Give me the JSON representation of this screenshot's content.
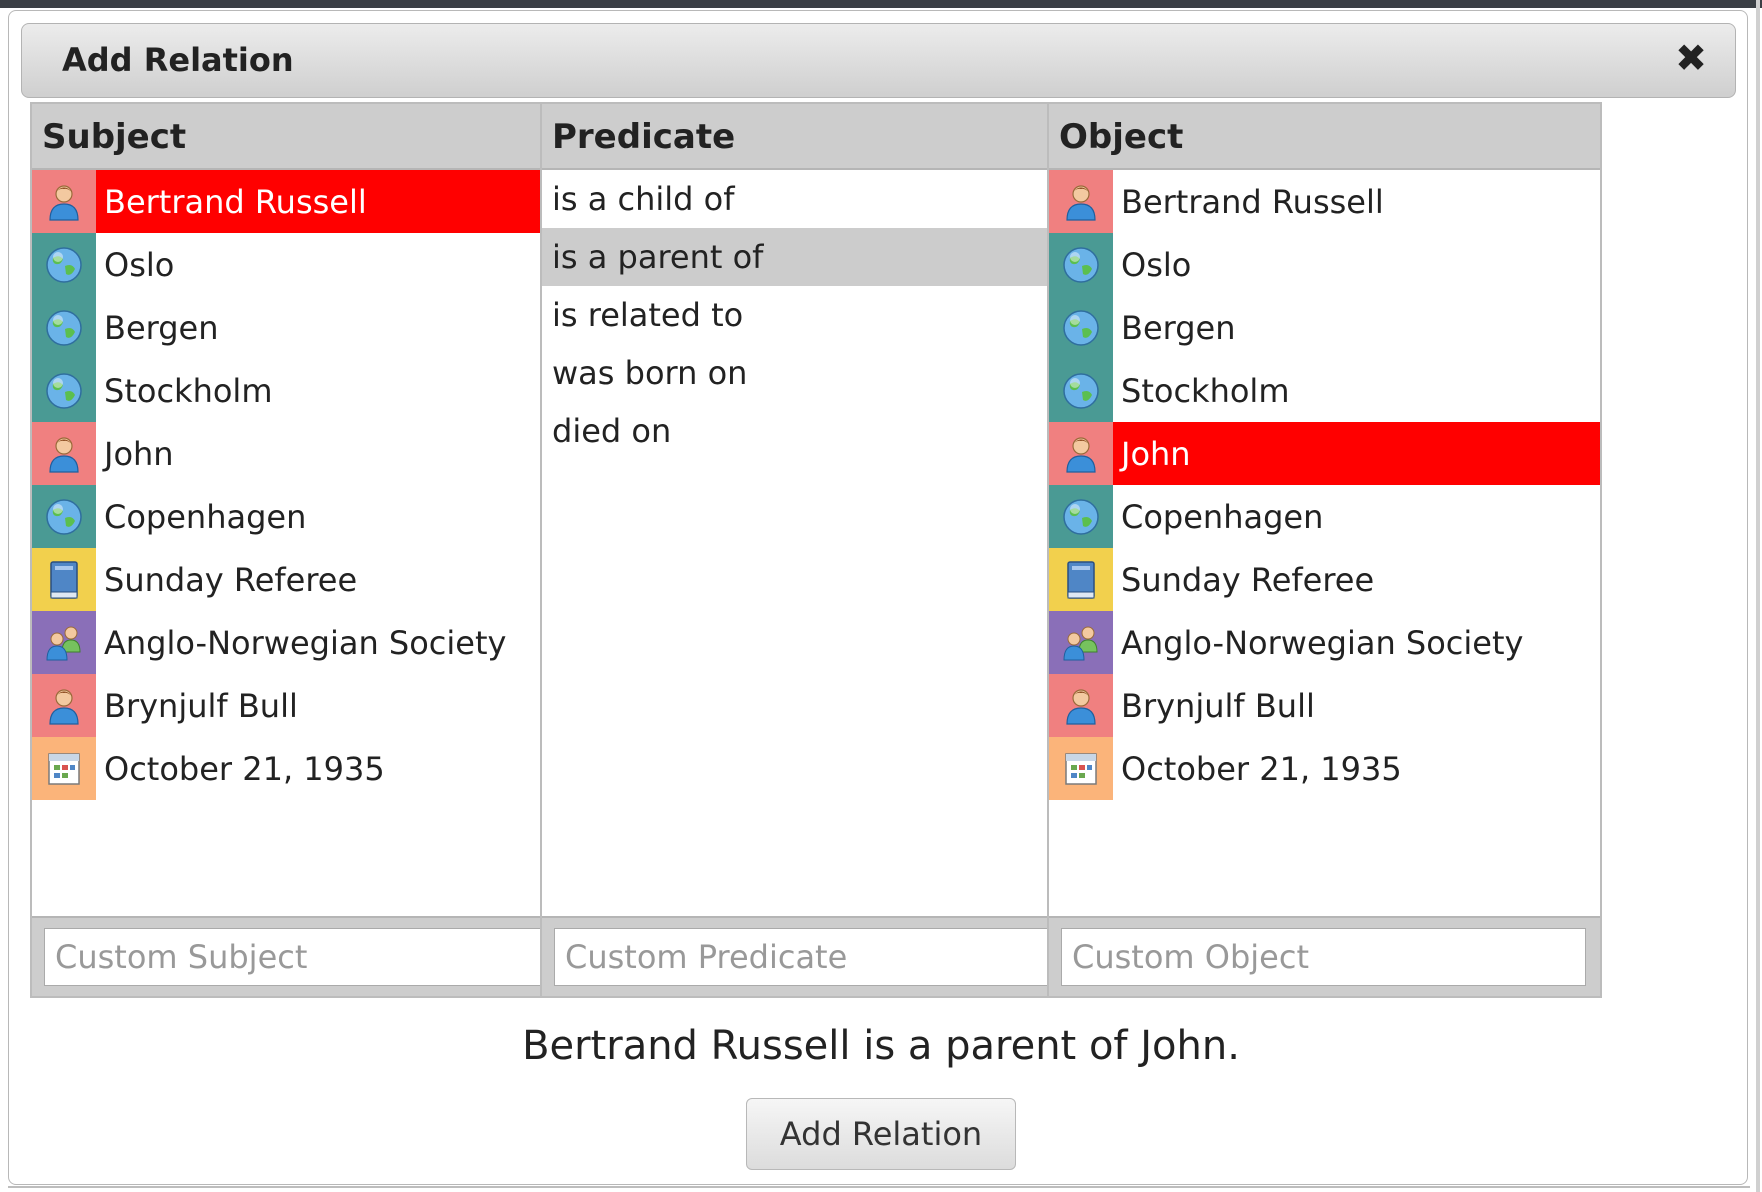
{
  "dialog": {
    "title": "Add Relation",
    "close_symbol": "✖"
  },
  "colors": {
    "selected_bg": "#ff0000",
    "person_bg": "#f08080",
    "place_bg": "#4a9a94",
    "book_bg": "#f2d04d",
    "group_bg": "#8a6fb8",
    "date_bg": "#fbb47a",
    "predicate_hover_bg": "#cccccc"
  },
  "subject": {
    "header": "Subject",
    "placeholder": "Custom Subject",
    "items": [
      {
        "label": "Bertrand Russell",
        "icon": "person-icon"
      },
      {
        "label": "Oslo",
        "icon": "globe-icon"
      },
      {
        "label": "Bergen",
        "icon": "globe-icon"
      },
      {
        "label": "Stockholm",
        "icon": "globe-icon"
      },
      {
        "label": "John",
        "icon": "person-icon"
      },
      {
        "label": "Copenhagen",
        "icon": "globe-icon"
      },
      {
        "label": "Sunday Referee",
        "icon": "book-icon"
      },
      {
        "label": "Anglo-Norwegian Society",
        "icon": "group-icon"
      },
      {
        "label": "Brynjulf Bull",
        "icon": "person-icon"
      },
      {
        "label": "October 21, 1935",
        "icon": "calendar-icon"
      }
    ],
    "selected": "Bertrand Russell"
  },
  "predicate": {
    "header": "Predicate",
    "placeholder": "Custom Predicate",
    "items": [
      "is a child of",
      "is a parent of",
      "is related to",
      "was born on",
      "died on"
    ],
    "highlighted": "is a parent of"
  },
  "object": {
    "header": "Object",
    "placeholder": "Custom Object",
    "items": [
      {
        "label": "Bertrand Russell",
        "icon": "person-icon"
      },
      {
        "label": "Oslo",
        "icon": "globe-icon"
      },
      {
        "label": "Bergen",
        "icon": "globe-icon"
      },
      {
        "label": "Stockholm",
        "icon": "globe-icon"
      },
      {
        "label": "John",
        "icon": "person-icon"
      },
      {
        "label": "Copenhagen",
        "icon": "globe-icon"
      },
      {
        "label": "Sunday Referee",
        "icon": "book-icon"
      },
      {
        "label": "Anglo-Norwegian Society",
        "icon": "group-icon"
      },
      {
        "label": "Brynjulf Bull",
        "icon": "person-icon"
      },
      {
        "label": "October 21, 1935",
        "icon": "calendar-icon"
      }
    ],
    "selected": "John"
  },
  "sentence": "Bertrand Russell is a parent of John.",
  "add_button_label": "Add Relation"
}
